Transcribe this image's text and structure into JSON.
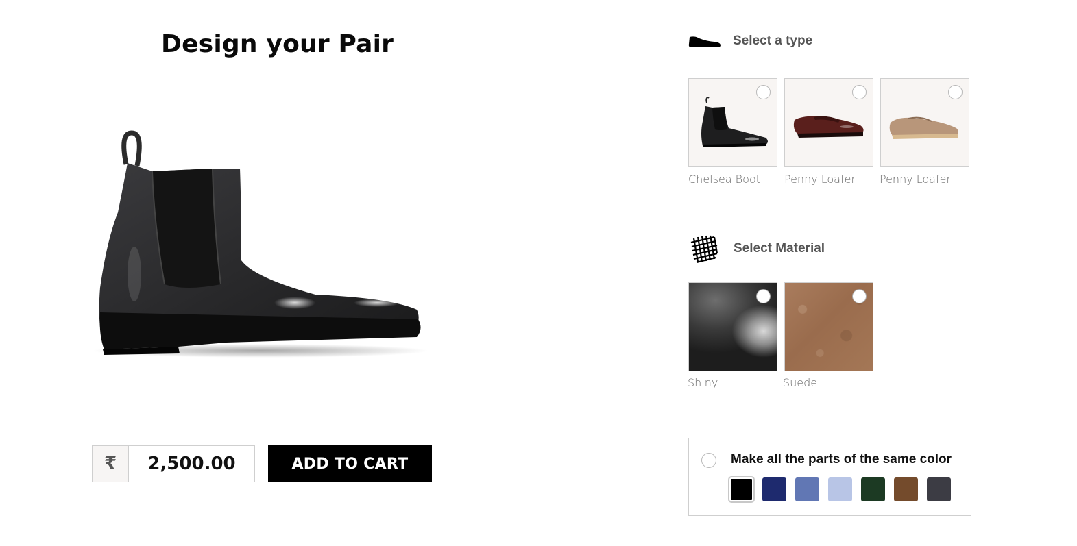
{
  "page_title": "Design your Pair",
  "purchase": {
    "currency_symbol": "₹",
    "price": "2,500.00",
    "add_to_cart_label": "ADD TO CART"
  },
  "type_section": {
    "title": "Select a type",
    "icon": "shoe-icon",
    "options": [
      {
        "label": "Chelsea Boot",
        "color": "#1a1a1a"
      },
      {
        "label": "Penny Loafer",
        "color": "#5a1f1c"
      },
      {
        "label": "Penny Loafer",
        "color": "#b8967a"
      }
    ]
  },
  "material_section": {
    "title": "Select Material",
    "icon": "mesh-texture-icon",
    "options": [
      {
        "label": "Shiny"
      },
      {
        "label": "Suede"
      }
    ]
  },
  "color_section": {
    "title": "Make all the parts of the same color",
    "swatches": [
      "#000000",
      "#1e2a6e",
      "#6177b4",
      "#b8c5e6",
      "#1c3a23",
      "#744b2c",
      "#3c3c44"
    ],
    "selected_index": 0
  }
}
